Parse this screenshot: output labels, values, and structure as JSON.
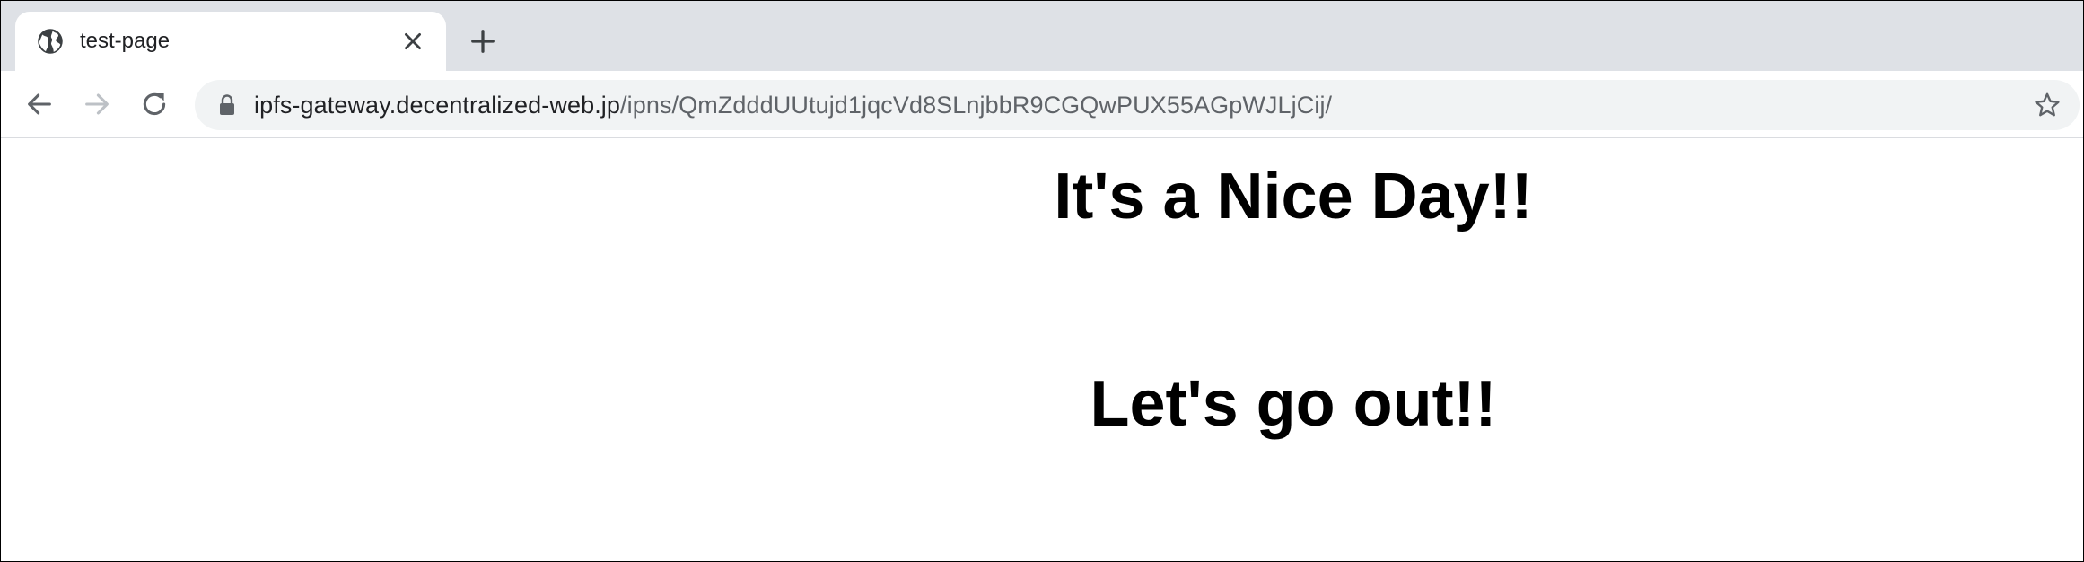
{
  "browser": {
    "tab": {
      "title": "test-page",
      "favicon": "globe-icon",
      "close_icon": "close-icon"
    },
    "new_tab_icon": "plus-icon",
    "toolbar": {
      "back_icon": "arrow-left-icon",
      "forward_icon": "arrow-right-icon",
      "reload_icon": "reload-icon",
      "lock_icon": "lock-icon",
      "url_host": "ipfs-gateway.decentralized-web.jp",
      "url_path": "/ipns/QmZdddUUtujd1jqcVd8SLnjbbR9CGQwPUX55AGpWJLjCij/",
      "bookmark_icon": "star-icon"
    },
    "colors": {
      "tabstrip": "#dee1e6",
      "omnibox": "#f1f3f4",
      "text_primary": "#202124",
      "text_secondary": "#5f6368"
    }
  },
  "page": {
    "heading_1": "It's a Nice Day!!",
    "heading_2": "Let's go out!!"
  }
}
